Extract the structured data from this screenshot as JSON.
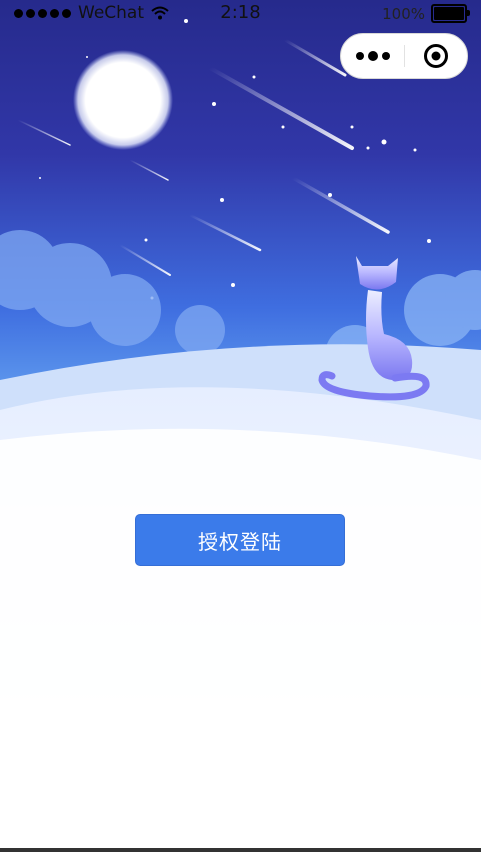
{
  "status_bar": {
    "carrier": "WeChat",
    "time": "2:18",
    "battery_percent": "100%",
    "battery_level": 1.0,
    "signal_bars": 5
  },
  "capsule": {
    "more_icon": "more-dots-icon",
    "close_icon": "target-circle-icon"
  },
  "background": {
    "scene": "night-sky-meteors-moon-cat",
    "sky_top_color": "#2a2e9a",
    "sky_horizon_color": "#4a8cf0"
  },
  "login": {
    "button_label": "授权登陆",
    "button_color": "#3b7bea"
  }
}
